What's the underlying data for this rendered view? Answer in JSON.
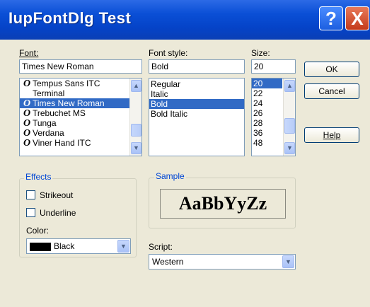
{
  "window": {
    "title": "IupFontDlg Test",
    "help_btn": "?",
    "close_btn": "X"
  },
  "font": {
    "label": "Font:",
    "value": "Times New Roman",
    "items": [
      {
        "icon": "O",
        "label": "Tempus Sans ITC"
      },
      {
        "icon": "",
        "label": "Terminal"
      },
      {
        "icon": "O",
        "label": "Times New Roman"
      },
      {
        "icon": "O",
        "label": "Trebuchet MS"
      },
      {
        "icon": "O",
        "label": "Tunga"
      },
      {
        "icon": "O",
        "label": "Verdana"
      },
      {
        "icon": "O",
        "label": "Viner Hand ITC"
      }
    ],
    "selected_index": 2
  },
  "style": {
    "label": "Font style:",
    "value": "Bold",
    "items": [
      "Regular",
      "Italic",
      "Bold",
      "Bold Italic"
    ],
    "selected_index": 2
  },
  "size": {
    "label": "Size:",
    "value": "20",
    "items": [
      "20",
      "22",
      "24",
      "26",
      "28",
      "36",
      "48"
    ],
    "selected_index": 0
  },
  "buttons": {
    "ok": "OK",
    "cancel": "Cancel",
    "help": "Help"
  },
  "effects": {
    "title": "Effects",
    "strikeout": "Strikeout",
    "underline": "Underline",
    "color_label": "Color:",
    "color_value": "Black"
  },
  "sample": {
    "title": "Sample",
    "text": "AaBbYyZz"
  },
  "script": {
    "label": "Script:",
    "value": "Western"
  },
  "colors": {
    "title_bar": "#0a4fd6",
    "selection": "#316ac5",
    "group_title": "#0046d5",
    "dialog_bg": "#ece9d8"
  }
}
